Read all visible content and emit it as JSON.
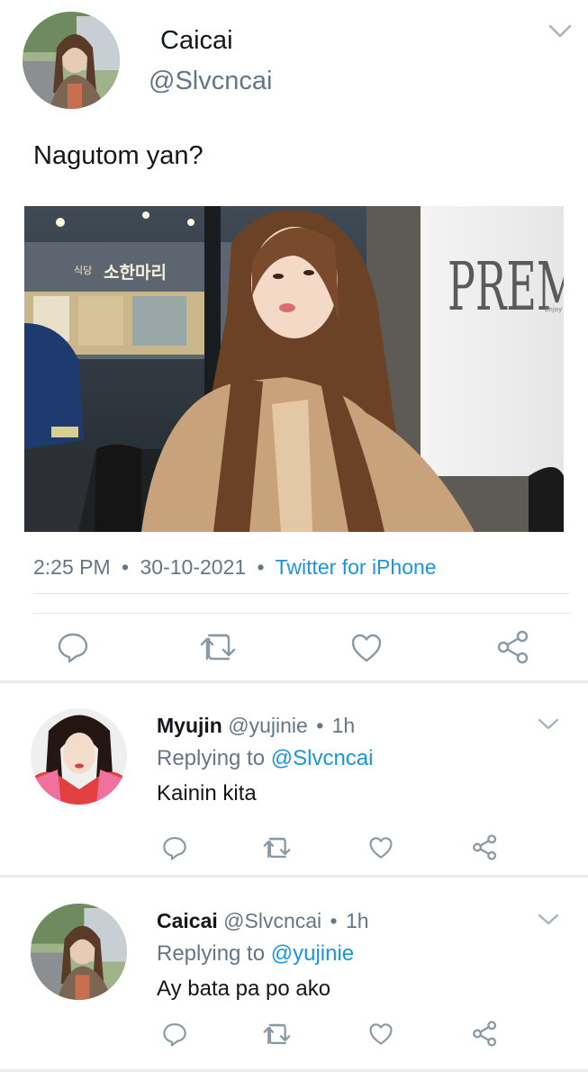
{
  "main_tweet": {
    "display_name": "Caicai",
    "handle": "@Slvcncai",
    "text": "Nagutom yan?",
    "time": "2:25 PM",
    "date": "30-10-2021",
    "source": "Twitter for iPhone",
    "separator": "•",
    "photo_signs": {
      "store_sign_korean": "소한마리",
      "store_sign_left": "식당",
      "wall_sign": "PREMIUM PIZ",
      "wall_sign_small": "Enjoy th"
    }
  },
  "replies": [
    {
      "display_name": "Myujin",
      "handle": "@yujinie",
      "separator": "•",
      "time": "1h",
      "replying_prefix": "Replying to",
      "replying_to": "@Slvcncai",
      "text": "Kainin kita"
    },
    {
      "display_name": "Caicai",
      "handle": "@Slvcncai",
      "separator": "•",
      "time": "1h",
      "replying_prefix": "Replying to",
      "replying_to": "@yujinie",
      "text": "Ay bata pa po ako"
    }
  ],
  "icons": {
    "reply": "reply-icon",
    "retweet": "retweet-icon",
    "like": "like-icon",
    "share": "share-icon",
    "more": "chevron-down-icon"
  },
  "colors": {
    "link": "#1b95e0",
    "muted": "#657786",
    "divider": "#e6ecf0",
    "text": "#14171a"
  }
}
